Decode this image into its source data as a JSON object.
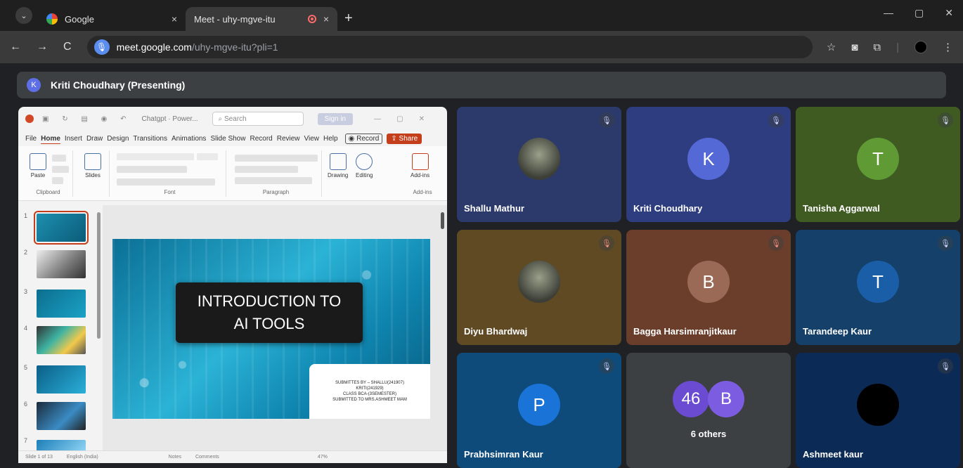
{
  "browser": {
    "tabs": [
      {
        "title": "Google",
        "close": "×"
      },
      {
        "title": "Meet - uhy-mgve-itu",
        "close": "×"
      }
    ],
    "new_tab": "+",
    "url_host": "meet.google.com",
    "url_path": "/uhy-mgve-itu?pli=1",
    "nav": {
      "back": "←",
      "forward": "→",
      "reload": "C"
    },
    "window": {
      "min": "—",
      "max": "▢",
      "close": "✕"
    }
  },
  "meet": {
    "presenter_initial": "K",
    "presenter_label": "Kriti Choudhary (Presenting)"
  },
  "ppt": {
    "file_name": "Chatgpt · Power...",
    "search": "Search",
    "sign_in": "Sign in",
    "menu": [
      "File",
      "Home",
      "Insert",
      "Draw",
      "Design",
      "Transitions",
      "Animations",
      "Slide Show",
      "Record",
      "Review",
      "View",
      "Help"
    ],
    "record": "Record",
    "share": "Share",
    "ribbon": {
      "clipboard": "Clipboard",
      "paste": "Paste",
      "slides": "Slides",
      "font": "Font",
      "paragraph": "Paragraph",
      "drawing": "Drawing",
      "editing": "Editing",
      "addins": "Add-ins",
      "addins_group": "Add-ins"
    },
    "thumb_numbers": [
      "1",
      "2",
      "3",
      "4",
      "5",
      "6",
      "7"
    ],
    "slide_title": "INTRODUCTION TO\nAI TOOLS",
    "slide_sub": "SUBMITTES BY – SHALLU(241907)\nKRITI(241929)\nCLASS BCA-(3SEMESTER)\nSUBMITTED TO MRS.ASHMEET MAM",
    "status": {
      "slide": "Slide 1 of 13",
      "lang": "English (India)",
      "notes": "Notes",
      "comments": "Comments",
      "zoom": "47%"
    }
  },
  "participants": [
    {
      "name": "Shallu Mathur",
      "type": "photo",
      "bg": "#2b3a6b",
      "avatar_bg": "#4a4f55"
    },
    {
      "name": "Kriti Choudhary",
      "type": "initial",
      "initial": "K",
      "bg": "#2e3d7f",
      "avatar_bg": "#5468d6"
    },
    {
      "name": "Tanisha Aggarwal",
      "type": "initial",
      "initial": "T",
      "bg": "#3f5b22",
      "avatar_bg": "#5f9a35"
    },
    {
      "name": "Diyu Bhardwaj",
      "type": "photo",
      "bg": "#5f4a24",
      "avatar_bg": "#7a7f6a"
    },
    {
      "name": "Bagga Harsimranjitkaur",
      "type": "initial",
      "initial": "B",
      "bg": "#6a3e2b",
      "avatar_bg": "#9b6a57"
    },
    {
      "name": "Tarandeep Kaur",
      "type": "initial",
      "initial": "T",
      "bg": "#14406a",
      "avatar_bg": "#1a5ea8"
    },
    {
      "name": "Prabhsimran Kaur",
      "type": "initial",
      "initial": "P",
      "bg": "#0e4a7a",
      "avatar_bg": "#1a73d6"
    },
    {
      "name": "6 others",
      "type": "others",
      "count": "46",
      "initial": "B",
      "bg": "#3c4043"
    },
    {
      "name": "Ashmeet kaur",
      "type": "photo",
      "bg": "#0b2a55",
      "avatar_bg": "#000000"
    }
  ]
}
